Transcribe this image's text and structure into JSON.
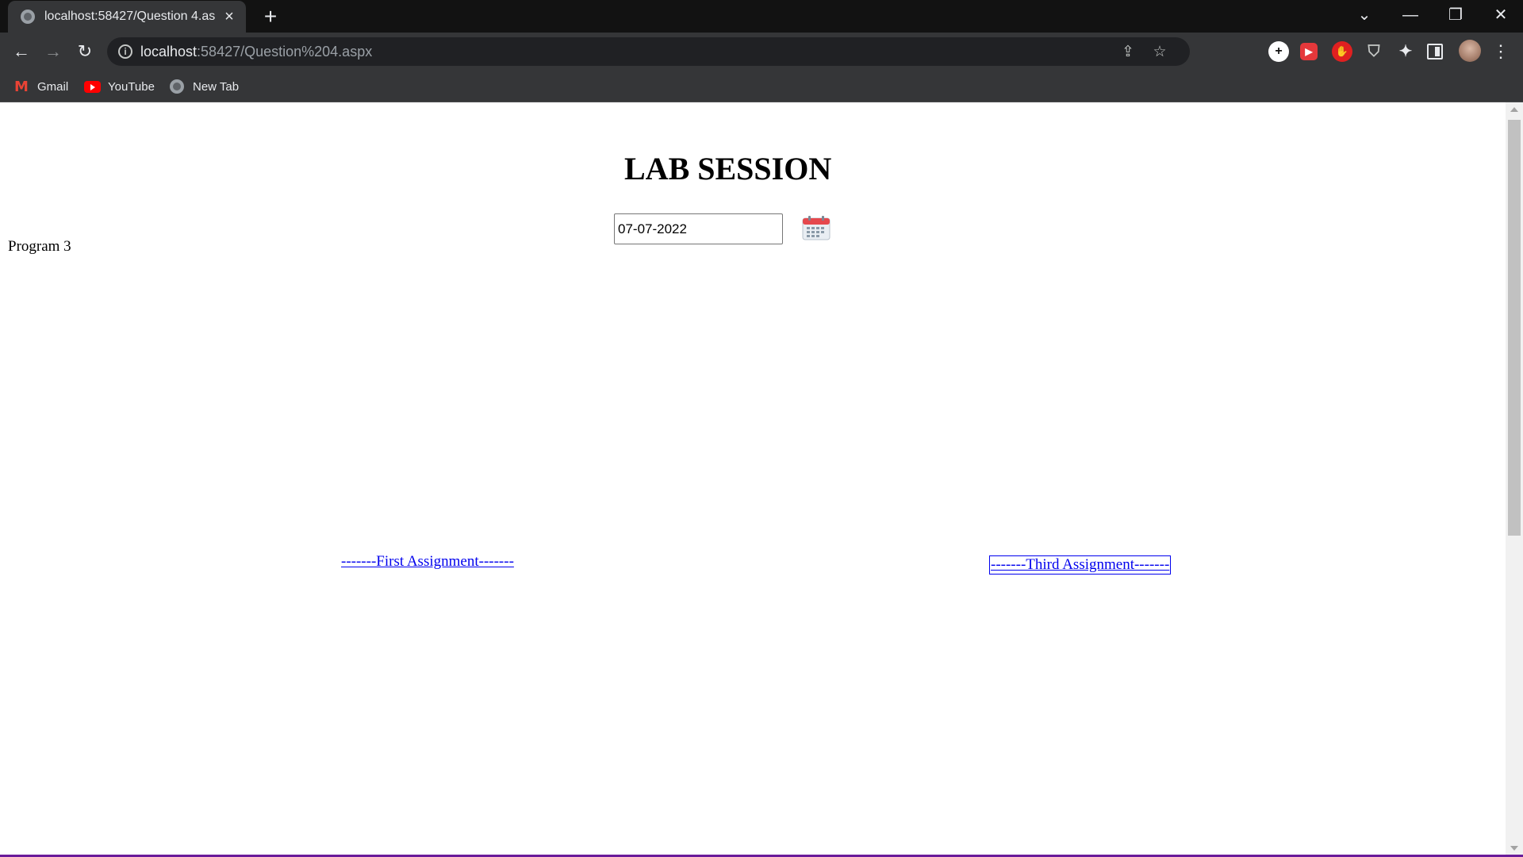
{
  "browser": {
    "tab_title": "localhost:58427/Question 4.aspx",
    "tab_close_icon": "×",
    "new_tab_icon": "+",
    "url_host": "localhost",
    "url_path": ":58427/Question%204.aspx",
    "nav_icons": {
      "back": "←",
      "forward": "→",
      "reload": "↻"
    },
    "bookmarks": [
      {
        "label": "Gmail",
        "icon": "gmail-icon"
      },
      {
        "label": "YouTube",
        "icon": "youtube-icon"
      },
      {
        "label": "New Tab",
        "icon": "globe-icon"
      }
    ],
    "window_controls": {
      "tab_search": "⌄",
      "minimize": "—",
      "maximize": "❐",
      "close": "✕"
    }
  },
  "page": {
    "title": "LAB SESSION",
    "date_value": "07-07-2022",
    "program_label": "Program 3",
    "links": {
      "first": "-------First Assignment-------",
      "third": "-------Third Assignment-------"
    }
  },
  "colors": {
    "link": "#0000ee",
    "chrome_dark": "#121212",
    "chrome_toolbar": "#353638"
  }
}
